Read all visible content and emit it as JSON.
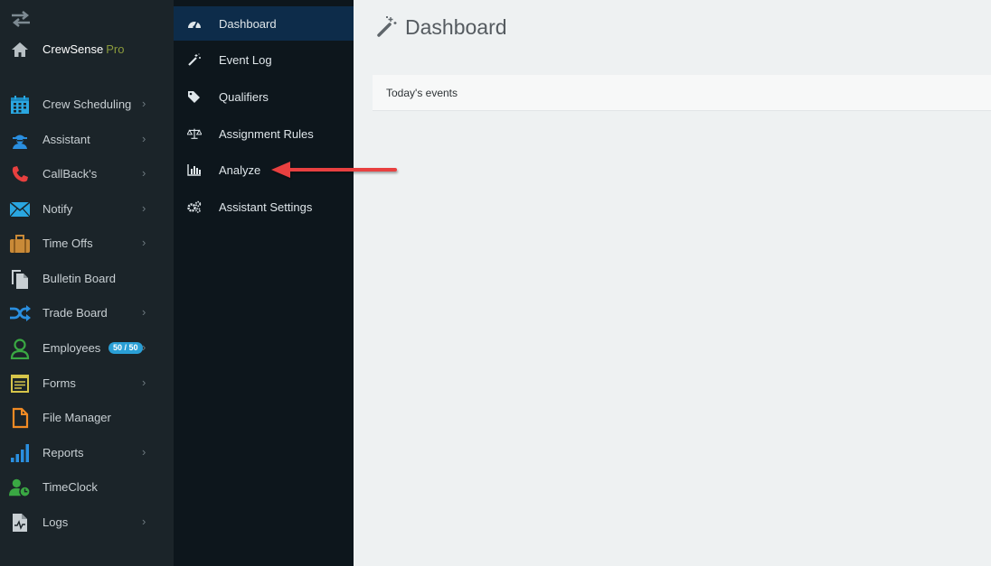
{
  "brand": {
    "name": "CrewSense",
    "tier": "Pro"
  },
  "sidebar": {
    "items": [
      {
        "label": "Crew Scheduling",
        "icon": "calendar-icon",
        "has_submenu": true
      },
      {
        "label": "Assistant",
        "icon": "assistant-icon",
        "has_submenu": true
      },
      {
        "label": "CallBack's",
        "icon": "phone-icon",
        "has_submenu": true
      },
      {
        "label": "Notify",
        "icon": "envelope-icon",
        "has_submenu": true
      },
      {
        "label": "Time Offs",
        "icon": "suitcase-icon",
        "has_submenu": true
      },
      {
        "label": "Bulletin Board",
        "icon": "copy-icon",
        "has_submenu": false
      },
      {
        "label": "Trade Board",
        "icon": "shuffle-icon",
        "has_submenu": true
      },
      {
        "label": "Employees",
        "icon": "user-icon",
        "has_submenu": true,
        "badge": "50 / 50"
      },
      {
        "label": "Forms",
        "icon": "form-icon",
        "has_submenu": true
      },
      {
        "label": "File Manager",
        "icon": "file-icon",
        "has_submenu": false
      },
      {
        "label": "Reports",
        "icon": "signal-icon",
        "has_submenu": true
      },
      {
        "label": "TimeClock",
        "icon": "user-clock-icon",
        "has_submenu": false
      },
      {
        "label": "Logs",
        "icon": "log-file-icon",
        "has_submenu": true
      }
    ]
  },
  "submenu": {
    "items": [
      {
        "label": "Dashboard",
        "icon": "tachometer-icon",
        "active": true
      },
      {
        "label": "Event Log",
        "icon": "magic-wand-icon",
        "active": false
      },
      {
        "label": "Qualifiers",
        "icon": "tags-icon",
        "active": false
      },
      {
        "label": "Assignment Rules",
        "icon": "balance-scale-icon",
        "active": false
      },
      {
        "label": "Analyze",
        "icon": "bar-chart-icon",
        "active": false
      },
      {
        "label": "Assistant Settings",
        "icon": "gears-icon",
        "active": false
      }
    ]
  },
  "main": {
    "title": "Dashboard",
    "panel_title": "Today's events"
  },
  "colors": {
    "sidebar_bg": "#1b2429",
    "submenu_bg": "#0d161c",
    "submenu_active": "#0d2c4a",
    "main_bg": "#eef1f2",
    "badge": "#2a9fd6",
    "annotation_arrow": "#e8403f"
  }
}
